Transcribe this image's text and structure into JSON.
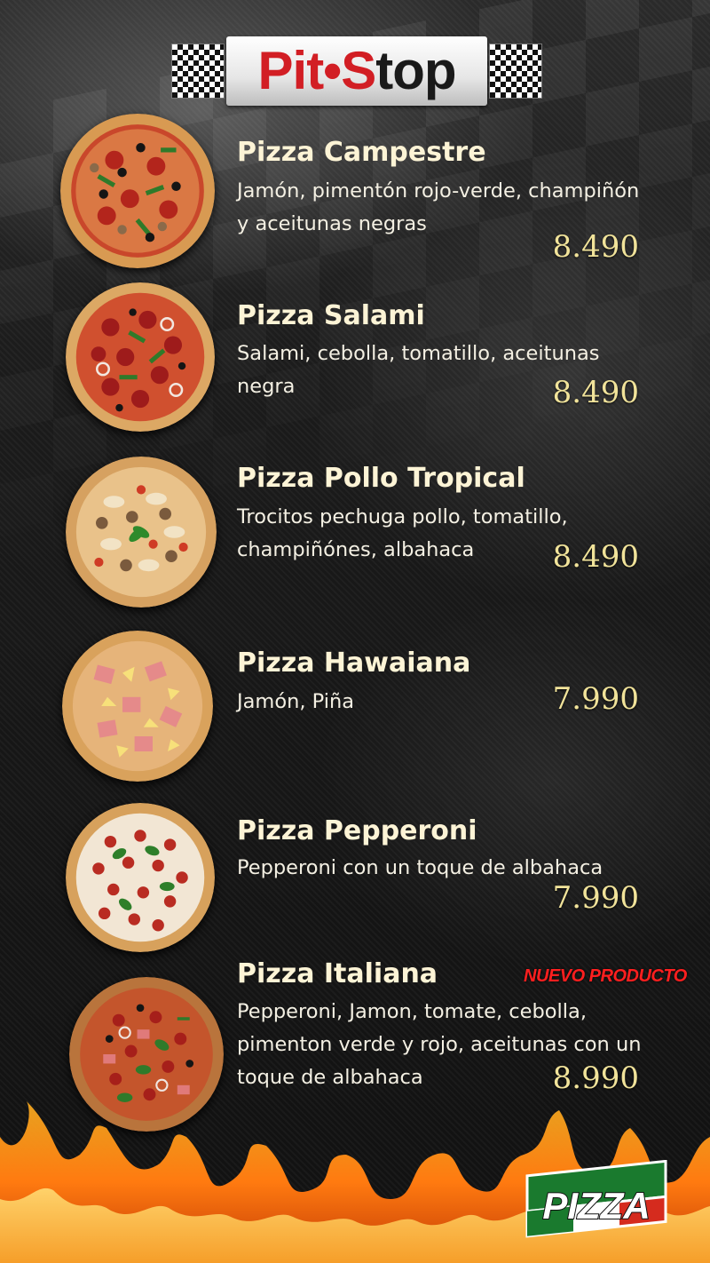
{
  "brand": {
    "logo_left": "Pit",
    "logo_dot": "•",
    "logo_right": "Stop",
    "logo_color_red": "#d21e24",
    "logo_color_dark": "#1a1a1a"
  },
  "menu": [
    {
      "name": "Pizza Campestre",
      "description": "Jamón, pimentón rojo-verde, champiñón y aceitunas negras",
      "price": "8.490"
    },
    {
      "name": "Pizza Salami",
      "description": "Salami, cebolla, tomatillo, aceitunas negra",
      "price": "8.490"
    },
    {
      "name": "Pizza Pollo Tropical",
      "description": "Trocitos pechuga pollo, tomatillo, champiñónes, albahaca",
      "price": "8.490"
    },
    {
      "name": "Pizza Hawaiana",
      "description": "Jamón, Piña",
      "price": "7.990"
    },
    {
      "name": "Pizza Pepperoni",
      "description": "Pepperoni con un toque de albahaca",
      "price": "7.990"
    },
    {
      "name": "Pizza Italiana",
      "description": "Pepperoni, Jamon, tomate, cebolla, pimenton verde y rojo, aceitunas con un toque de albahaca",
      "price": "8.990",
      "tag": "NUEVO PRODUCTO"
    }
  ],
  "badge": {
    "text": "PIZZA"
  },
  "colors": {
    "name_text": "#fdf4d6",
    "description_text": "#f4f0e3",
    "price_text": "#f1e39a",
    "new_tag": "#ff1f1f"
  }
}
